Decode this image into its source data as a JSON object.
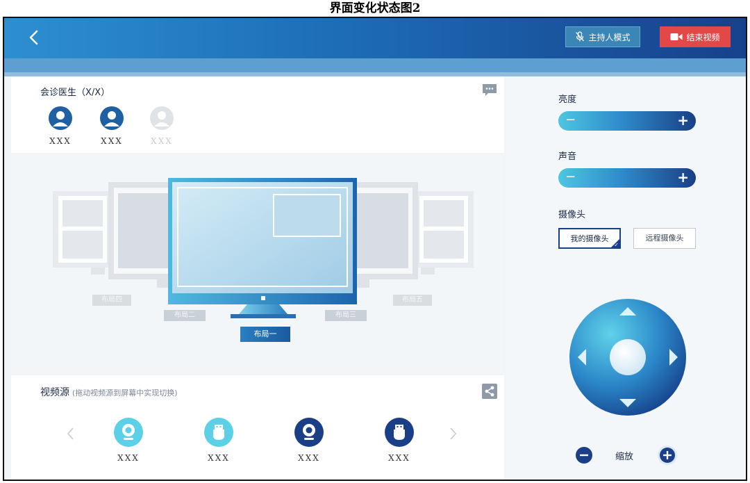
{
  "caption": "界面变化状态图2",
  "header": {
    "host_mode_label": "主持人模式",
    "end_video_label": "结束视频"
  },
  "doctors": {
    "title": "会诊医生（X/X）",
    "items": [
      {
        "name": "XXX",
        "status": "online"
      },
      {
        "name": "XXX",
        "status": "online"
      },
      {
        "name": "XXX",
        "status": "offline"
      }
    ]
  },
  "layouts": {
    "items": [
      {
        "label": "布局一",
        "selected": true
      },
      {
        "label": "布局二",
        "selected": false
      },
      {
        "label": "布局三",
        "selected": false
      },
      {
        "label": "布局四",
        "selected": false
      },
      {
        "label": "布局五",
        "selected": false
      }
    ]
  },
  "sources": {
    "title": "视频源",
    "hint": "(拖动视频源到屏幕中实现切换)",
    "items": [
      {
        "name": "XXX",
        "icon": "webcam-icon",
        "style": "light"
      },
      {
        "name": "XXX",
        "icon": "usb-icon",
        "style": "light"
      },
      {
        "name": "XXX",
        "icon": "webcam-icon",
        "style": "dark"
      },
      {
        "name": "XXX",
        "icon": "usb-icon",
        "style": "dark"
      }
    ]
  },
  "controls": {
    "brightness_label": "亮度",
    "volume_label": "声音",
    "camera_label": "摄像头",
    "my_camera_label": "我的摄像头",
    "remote_camera_label": "远程摄像头",
    "zoom_label": "缩放"
  },
  "colors": {
    "accent_dark": "#1a3f86",
    "accent_light": "#4ec6e0",
    "danger": "#e24848"
  }
}
